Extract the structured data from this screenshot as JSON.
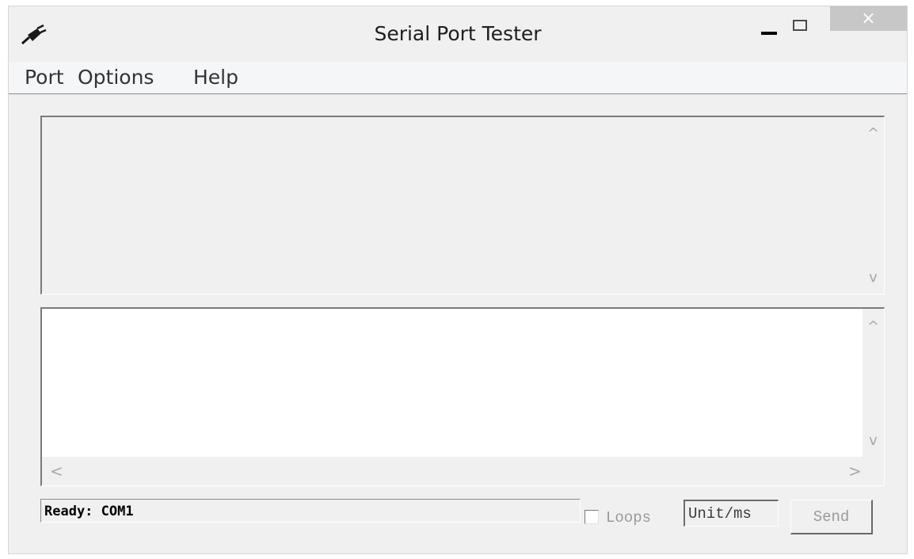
{
  "window": {
    "title": "Serial Port Tester",
    "app_icon": "serial-plug-icon",
    "controls": {
      "minimize": "minimize-icon",
      "maximize": "maximize-icon",
      "close": "×"
    }
  },
  "menubar": {
    "items": [
      {
        "label": "Port"
      },
      {
        "label": "Options"
      },
      {
        "label": "Help"
      }
    ]
  },
  "log_panel": {
    "content": "",
    "scroll_up": "^",
    "scroll_down": "v"
  },
  "input_panel": {
    "content": "",
    "scroll_up": "^",
    "scroll_down": "v",
    "scroll_left": "<",
    "scroll_right": ">"
  },
  "status": {
    "text": "Ready: COM1",
    "loops_label": "Loops",
    "loops_checked": false,
    "unit_placeholder": "Unit/ms",
    "send_label": "Send"
  },
  "colors": {
    "window_bg": "#f0f0f0",
    "close_button_bg": "#c7c7c7",
    "disabled_text": "#9a9a9a"
  }
}
